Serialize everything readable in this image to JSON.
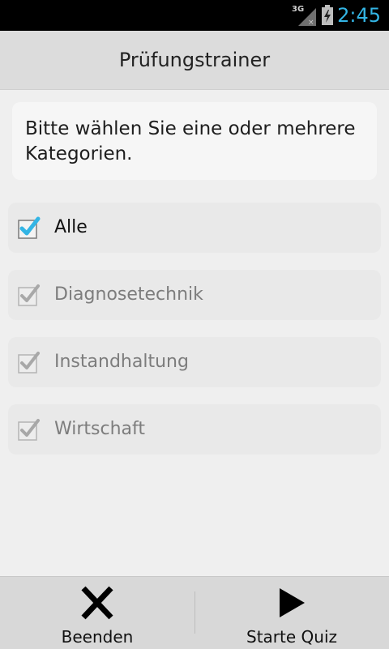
{
  "status_bar": {
    "network_label": "3G",
    "time": "2:45",
    "accent_color": "#33b5e5"
  },
  "app": {
    "title": "Prüfungstrainer"
  },
  "instruction": {
    "text": "Bitte wählen Sie eine oder mehrere Kategorien."
  },
  "categories": [
    {
      "label": "Alle",
      "checked": true,
      "enabled": true,
      "icon": "checkbox-checked-icon"
    },
    {
      "label": "Diagnosetechnik",
      "checked": true,
      "enabled": false,
      "icon": "checkbox-checked-disabled-icon"
    },
    {
      "label": "Instandhaltung",
      "checked": true,
      "enabled": false,
      "icon": "checkbox-checked-disabled-icon"
    },
    {
      "label": "Wirtschaft",
      "checked": true,
      "enabled": false,
      "icon": "checkbox-checked-disabled-icon"
    }
  ],
  "bottom_bar": {
    "quit": {
      "label": "Beenden",
      "icon": "close-x-icon"
    },
    "start": {
      "label": "Starte Quiz",
      "icon": "play-icon"
    }
  }
}
